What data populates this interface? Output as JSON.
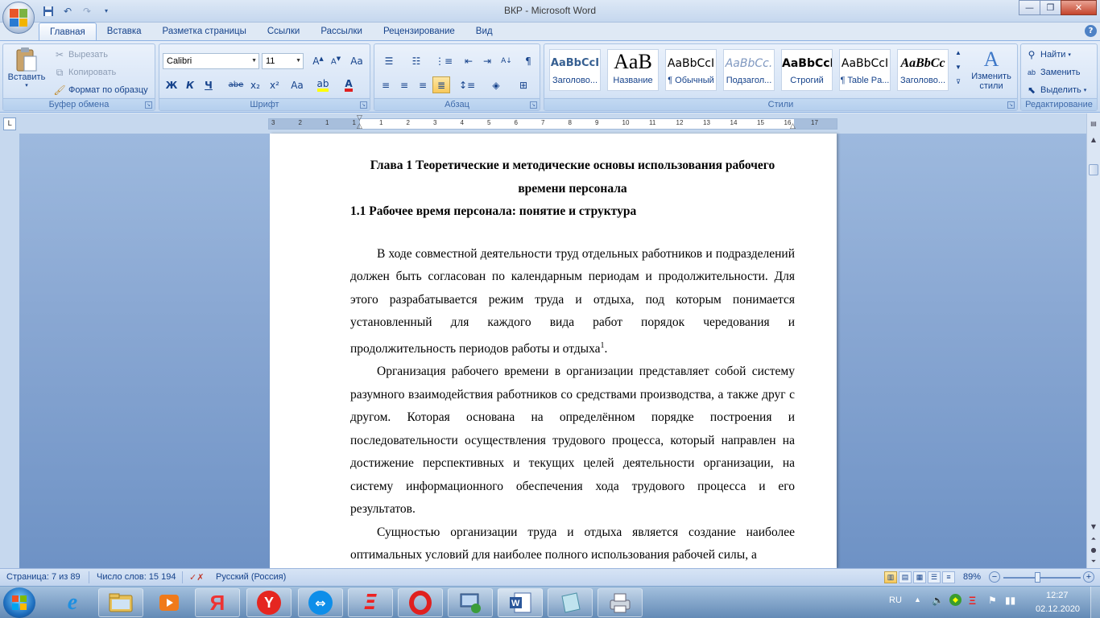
{
  "window": {
    "title": "ВКР - Microsoft Word"
  },
  "quick_access": {
    "icons": [
      "save-icon",
      "undo-icon",
      "redo-icon",
      "customize-icon"
    ]
  },
  "tabs": [
    "Главная",
    "Вставка",
    "Разметка страницы",
    "Ссылки",
    "Рассылки",
    "Рецензирование",
    "Вид"
  ],
  "active_tab": "Главная",
  "clipboard": {
    "label": "Буфер обмена",
    "paste": "Вставить",
    "cut": "Вырезать",
    "copy": "Копировать",
    "format_painter": "Формат по образцу"
  },
  "font": {
    "label": "Шрифт",
    "family": "Calibri",
    "size": "11",
    "bold": "Ж",
    "italic": "К",
    "underline": "Ч",
    "strike": "abe",
    "subscript": "x₂",
    "superscript": "x²",
    "case": "Aa"
  },
  "paragraph": {
    "label": "Абзац"
  },
  "styles": {
    "label": "Стили",
    "items": [
      {
        "preview": "AaBbCcI",
        "name": "Заголово..."
      },
      {
        "preview": "AaB",
        "name": "Название"
      },
      {
        "preview": "AaBbCcI",
        "name": "¶ Обычный"
      },
      {
        "preview": "AaBbCc.",
        "name": "Подзагол..."
      },
      {
        "preview": "AaBbCcD",
        "name": "Строгий"
      },
      {
        "preview": "AaBbCcI",
        "name": "¶ Table Pa..."
      },
      {
        "preview": "AaBbCc",
        "name": "Заголово..."
      }
    ],
    "change": "Изменить стили"
  },
  "editing": {
    "label": "Редактирование",
    "find": "Найти",
    "replace": "Заменить",
    "select": "Выделить"
  },
  "ruler": {
    "numbers": [
      "3",
      "2",
      "1",
      "1",
      "1",
      "2",
      "3",
      "4",
      "5",
      "6",
      "7",
      "8",
      "9",
      "10",
      "11",
      "12",
      "13",
      "14",
      "15",
      "16",
      "17"
    ]
  },
  "document": {
    "heading1": "Глава 1 Теоретические и методические основы использования рабочего времени персонала",
    "heading2": "1.1 Рабочее время персонала: понятие и структура",
    "para1": "В ходе совместной деятельности труд отдельных работников и подразделений должен быть согласован по календарным периодам и продолжительности. Для этого разрабатывается режим труда и отдыха, под которым понимается установленный для каждого вида работ порядок чередования и продолжительность периодов работы и отдыха",
    "para1_footnote": "1",
    "para1_end": ".",
    "para2": "Организация рабочего времени в организации представляет собой систему разумного взаимодействия работников со средствами производства, а также друг с другом. Которая основана на определённом порядке построения и последовательности осуществления трудового процесса, который направлен на достижение перспективных и текущих целей деятельности организации, на систему информационного обеспечения хода трудового процесса и его результатов.",
    "para3": "Сущностью организации труда и отдыха является создание наиболее оптимальных условий для наиболее полного использования рабочей силы, а"
  },
  "status": {
    "page": "Страница: 7 из 89",
    "words": "Число слов: 15 194",
    "language": "Русский (Россия)",
    "zoom": "89%"
  },
  "taskbar": {
    "apps": [
      "explorer-icon",
      "media-player-icon",
      "yandex-icon",
      "yandex-browser-icon",
      "teamviewer-icon",
      "antivirus-icon",
      "opera-icon",
      "network-icon",
      "word-icon",
      "notes-icon",
      "printer-icon"
    ],
    "lang": "RU",
    "time": "12:27",
    "date": "02.12.2020"
  },
  "colors": {
    "accent": "#15428b",
    "ribbon": "#d1e0f3",
    "workspace": "#8aa8d3",
    "taskbar": "#5f87b4"
  }
}
